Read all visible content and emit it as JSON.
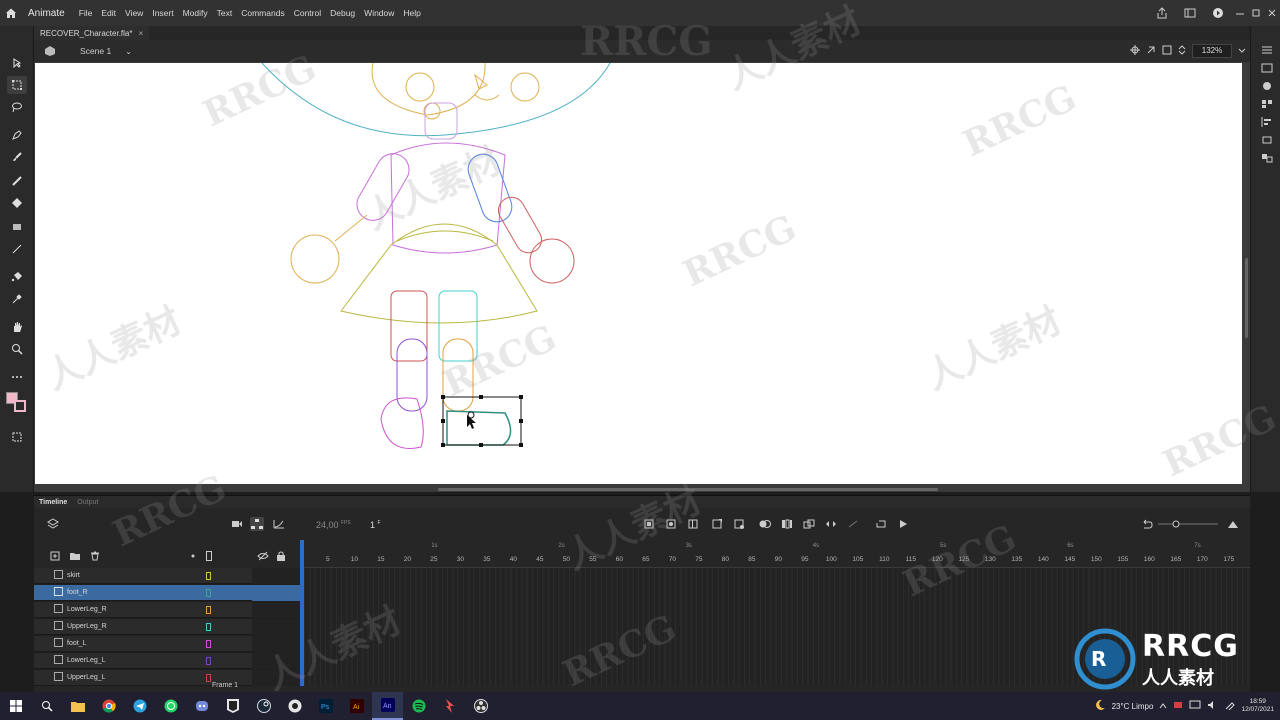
{
  "menubar": {
    "app_name": "Animate",
    "menus": [
      "File",
      "Edit",
      "View",
      "Insert",
      "Modify",
      "Text",
      "Commands",
      "Control",
      "Debug",
      "Window",
      "Help"
    ]
  },
  "document": {
    "tab_title": "RECOVER_Character.fla*",
    "scene": "Scene 1",
    "zoom": "132%"
  },
  "timeline": {
    "tabs": [
      "Timeline",
      "Output"
    ],
    "fps_value": "24,00",
    "fps_unit": "FPS",
    "current_frame": "1",
    "frame_unit": "F",
    "frame_label": "Frame 1",
    "seconds": [
      "1s",
      "2s",
      "3s",
      "4s",
      "5s",
      "6s",
      "7s"
    ],
    "ticks": [
      "5",
      "10",
      "15",
      "20",
      "25",
      "30",
      "35",
      "40",
      "45",
      "50",
      "55",
      "60",
      "65",
      "70",
      "75",
      "80",
      "85",
      "90",
      "95",
      "100",
      "105",
      "110",
      "115",
      "120",
      "125",
      "130",
      "135",
      "140",
      "145",
      "150",
      "155",
      "160",
      "165",
      "170",
      "175"
    ],
    "layers": [
      {
        "name": "skirt",
        "color": "#c9c94a",
        "selected": false
      },
      {
        "name": "foot_R",
        "color": "#3fa38f",
        "selected": true
      },
      {
        "name": "LowerLeg_R",
        "color": "#e0a040",
        "selected": false
      },
      {
        "name": "UpperLeg_R",
        "color": "#40d0d0",
        "selected": false
      },
      {
        "name": "foot_L",
        "color": "#d050d0",
        "selected": false
      },
      {
        "name": "LowerLeg_L",
        "color": "#8040c0",
        "selected": false
      },
      {
        "name": "UpperLeg_L",
        "color": "#d04040",
        "selected": false
      }
    ]
  },
  "taskbar": {
    "weather": "23°C  Limpo",
    "time": "18:59",
    "date": "12/07/2021"
  },
  "watermark": {
    "text": "RRCG",
    "text_cn": "人人素材",
    "logo_text": "RRCG",
    "logo_sub": "人人素材"
  }
}
